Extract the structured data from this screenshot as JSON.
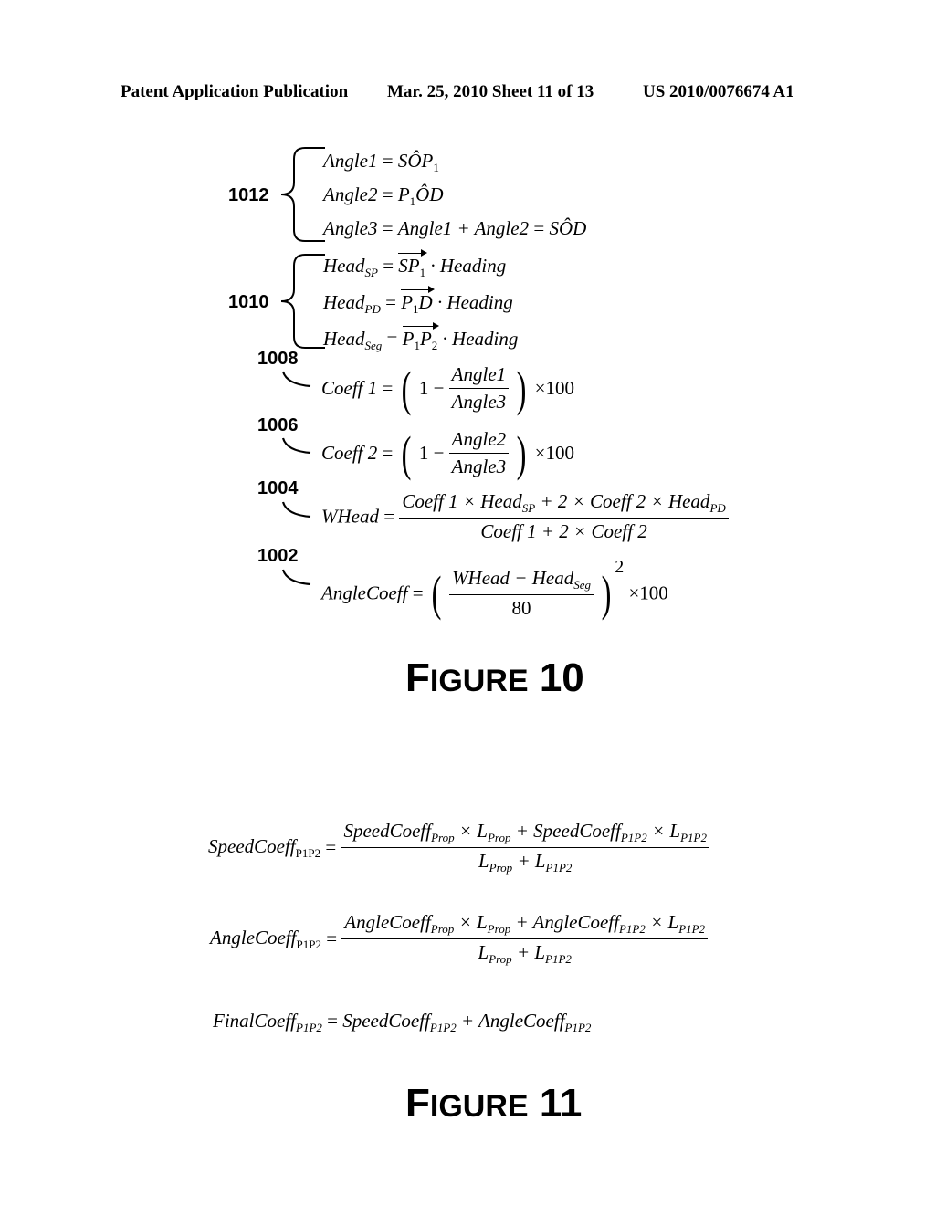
{
  "header": {
    "publication": "Patent Application Publication",
    "date_sheet": "Mar. 25, 2010  Sheet 11 of 13",
    "patent_number": "US 2010/0076674 A1"
  },
  "figure10": {
    "caption_first": "F",
    "caption_rest": "IGURE",
    "caption_number": "10",
    "refs": {
      "r1012": "1012",
      "r1010": "1010",
      "r1008": "1008",
      "r1006": "1006",
      "r1004": "1004",
      "r1002": "1002"
    },
    "eq1012": [
      {
        "lhs": "Angle1",
        "rhs": "SÔP",
        "rhs_sub": "1"
      },
      {
        "lhs": "Angle2",
        "rhs_pre": "P",
        "rhs_pre_sub": "1",
        "rhs": "ÔD"
      },
      {
        "lhs": "Angle3",
        "rhs": "Angle1 + Angle2",
        "rhs2": "SÔD"
      }
    ],
    "eq1010": [
      {
        "lhs": "Head",
        "lhs_sub": "SP",
        "vec": "SP",
        "vec_sub": "1",
        "rhs": "· Heading"
      },
      {
        "lhs": "Head",
        "lhs_sub": "PD",
        "vec": "P",
        "vec_sub": "1",
        "vec_tail": "D",
        "rhs": "· Heading"
      },
      {
        "lhs": "Head",
        "lhs_sub": "Seg",
        "vec": "P",
        "vec_sub": "1",
        "vec_tail": "P",
        "vec_tail_sub": "2",
        "rhs": "· Heading"
      }
    ],
    "eq1008": {
      "lhs": "Coeff 1",
      "one": "1",
      "minus": "−",
      "num": "Angle1",
      "den": "Angle3",
      "times": "×100"
    },
    "eq1006": {
      "lhs": "Coeff 2",
      "one": "1",
      "minus": "−",
      "num": "Angle2",
      "den": "Angle3",
      "times": "×100"
    },
    "eq1004": {
      "lhs": "WHead",
      "num_a": "Coeff 1 × Head",
      "num_a_sub": "SP",
      "num_b": " + 2 × Coeff 2 × Head",
      "num_b_sub": "PD",
      "den": "Coeff 1 + 2 × Coeff 2"
    },
    "eq1002": {
      "lhs": "AngleCoeff",
      "num": "WHead − Head",
      "num_sub": "Seg",
      "den": "80",
      "power": "2",
      "times": "×100"
    }
  },
  "figure11": {
    "caption_first": "F",
    "caption_rest": "IGURE",
    "caption_number": "11",
    "speed": {
      "lhs": "SpeedCoeff",
      "lhs_sub": "P1P2",
      "num_a": "SpeedCoeff",
      "num_a_sub": "Prop",
      "num_b": " × L",
      "num_b_sub": "Prop",
      "num_c": " + SpeedCoeff",
      "num_c_sub": "P1P2",
      "num_d": " × L",
      "num_d_sub": "P1P2",
      "den_a": "L",
      "den_a_sub": "Prop",
      "den_b": " + L",
      "den_b_sub": "P1P2"
    },
    "angle": {
      "lhs": "AngleCoeff",
      "lhs_sub": "P1P2",
      "num_a": "AngleCoeff",
      "num_a_sub": "Prop",
      "num_b": " × L",
      "num_b_sub": "Prop",
      "num_c": " + AngleCoeff",
      "num_c_sub": "P1P2",
      "num_d": " × L",
      "num_d_sub": "P1P2",
      "den_a": "L",
      "den_a_sub": "Prop",
      "den_b": " + L",
      "den_b_sub": "P1P2"
    },
    "final": {
      "lhs": "FinalCoeff",
      "lhs_sub": "P1P2",
      "a": "SpeedCoeff",
      "a_sub": "P1P2",
      "b": " + AngleCoeff",
      "b_sub": "P1P2"
    }
  }
}
